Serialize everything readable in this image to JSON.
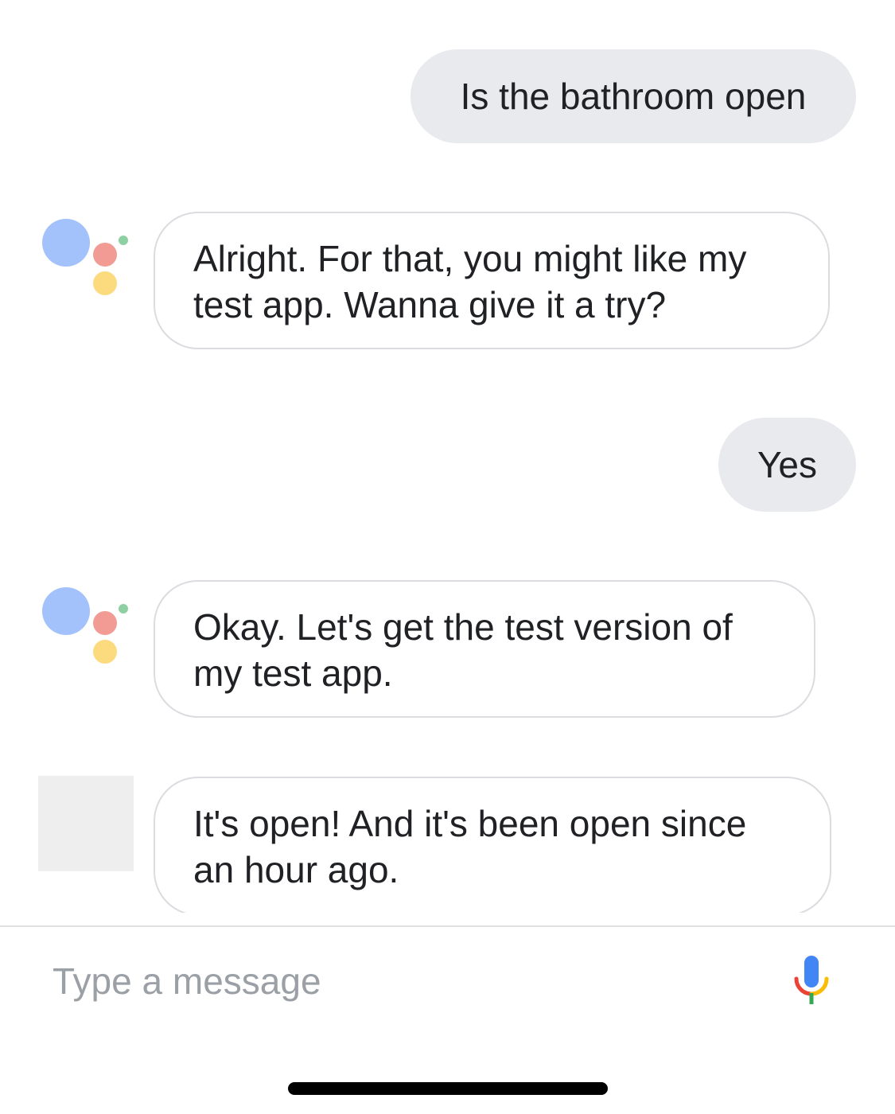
{
  "conversation": {
    "messages": [
      {
        "sender": "user",
        "text": "Is the bathroom open"
      },
      {
        "sender": "assistant",
        "lines": [
          "Alright. For that, you might like my",
          "test app. Wanna give it a try?"
        ]
      },
      {
        "sender": "user",
        "text": "Yes"
      },
      {
        "sender": "assistant",
        "lines": [
          "Okay. Let's get the test version of",
          "my test app."
        ]
      },
      {
        "sender": "app",
        "lines": [
          "It's open! And it's been open since",
          "an hour ago."
        ]
      }
    ]
  },
  "composer": {
    "placeholder": "Type a message",
    "mic_icon": "microphone-icon"
  },
  "colors": {
    "user_bubble": "#e8eaed",
    "bot_bubble_border": "#dadce0",
    "logo_blue": "#a3c1fb",
    "logo_red": "#f29b94",
    "logo_yellow": "#fcdb7e",
    "logo_green": "#8fd0a3",
    "placeholder_text": "#9aa0a6"
  }
}
